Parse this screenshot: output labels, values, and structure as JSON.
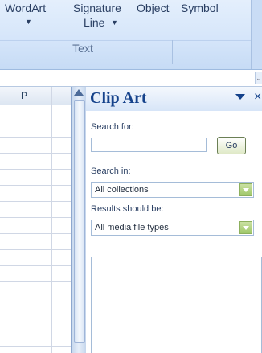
{
  "ribbon": {
    "wordart_label": "WordArt",
    "signature_label": "Signature",
    "signature_line_label": "Line",
    "object_label": "Object",
    "symbol_label": "Symbol",
    "group_label": "Text"
  },
  "sheet": {
    "column_header": "P"
  },
  "clip_art": {
    "title": "Clip Art",
    "close_glyph": "×",
    "search_for_label": "Search for:",
    "search_value": "",
    "go_label": "Go",
    "search_in_label": "Search in:",
    "search_in_value": "All collections",
    "results_label": "Results should be:",
    "results_value": "All media file types"
  },
  "colors": {
    "accent": "#15428b",
    "go_button_bg": "#dfe9c7",
    "select_button": "#9fc86a"
  }
}
